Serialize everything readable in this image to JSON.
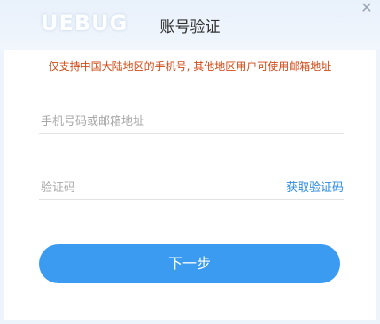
{
  "window": {
    "title": "账号验证",
    "watermark": "UEBUG",
    "close_icon": "close-icon"
  },
  "form": {
    "notice": "仅支持中国大陆地区的手机号, 其他地区用户可使用邮箱地址",
    "phone_placeholder": "手机号码或邮箱地址",
    "phone_value": "",
    "code_placeholder": "验证码",
    "code_value": "",
    "get_code_label": "获取验证码",
    "next_label": "下一步"
  },
  "colors": {
    "accent": "#3a9bf0",
    "notice": "#d04a16",
    "link": "#2f8ce4"
  }
}
